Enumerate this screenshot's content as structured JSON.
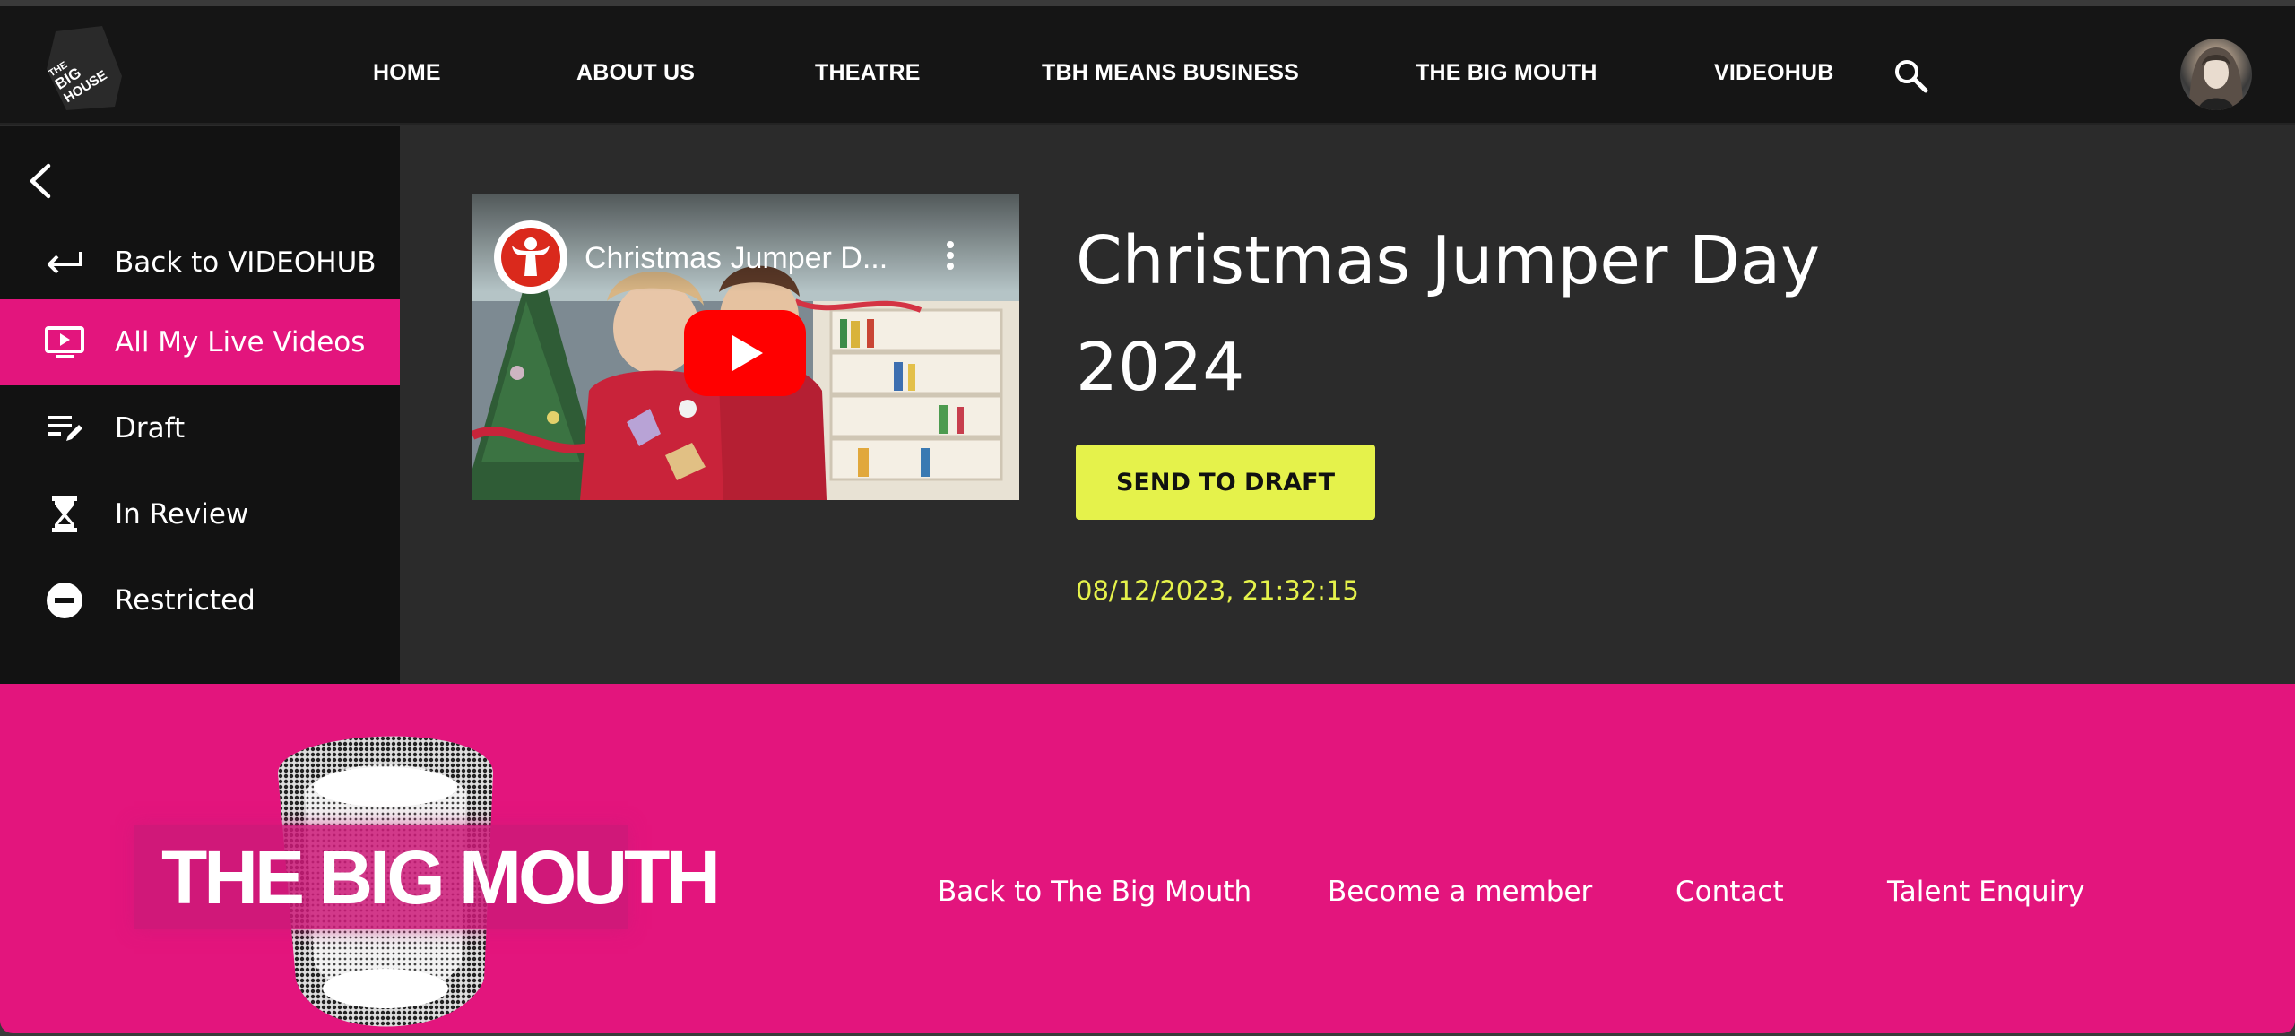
{
  "header": {
    "logo_text": "THE BIG HOUSE",
    "nav": [
      {
        "label": "HOME"
      },
      {
        "label": "ABOUT US"
      },
      {
        "label": "THEATRE"
      },
      {
        "label": "TBH MEANS BUSINESS"
      },
      {
        "label": "THE BIG MOUTH"
      },
      {
        "label": "VIDEOHUB"
      }
    ],
    "search_icon": "search-icon"
  },
  "sidebar": {
    "collapse_icon": "chevron-left-icon",
    "items": [
      {
        "label": "Back to VIDEOHUB",
        "icon": "return-arrow-icon",
        "active": false
      },
      {
        "label": "All My Live Videos",
        "icon": "live-tv-icon",
        "active": true
      },
      {
        "label": "Draft",
        "icon": "edit-list-icon",
        "active": false
      },
      {
        "label": "In Review",
        "icon": "hourglass-icon",
        "active": false
      },
      {
        "label": "Restricted",
        "icon": "minus-circle-icon",
        "active": false
      }
    ]
  },
  "video": {
    "title": "Christmas Jumper D...",
    "channel_icon": "save-the-children-icon",
    "play_icon": "youtube-play-icon"
  },
  "main": {
    "title": "Christmas Jumper Day 2024",
    "send_to_draft_label": "SEND TO DRAFT",
    "timestamp": "08/12/2023, 21:32:15"
  },
  "footer": {
    "brand": "THE BIG MOUTH",
    "links": [
      {
        "label": "Back to The Big Mouth"
      },
      {
        "label": "Become a member"
      },
      {
        "label": "Contact"
      },
      {
        "label": "Talent Enquiry"
      }
    ]
  },
  "colors": {
    "accent_pink": "#e3157d",
    "accent_yellow": "#e5f24b",
    "header_bg": "#151515",
    "main_bg": "#2b2b2b"
  }
}
